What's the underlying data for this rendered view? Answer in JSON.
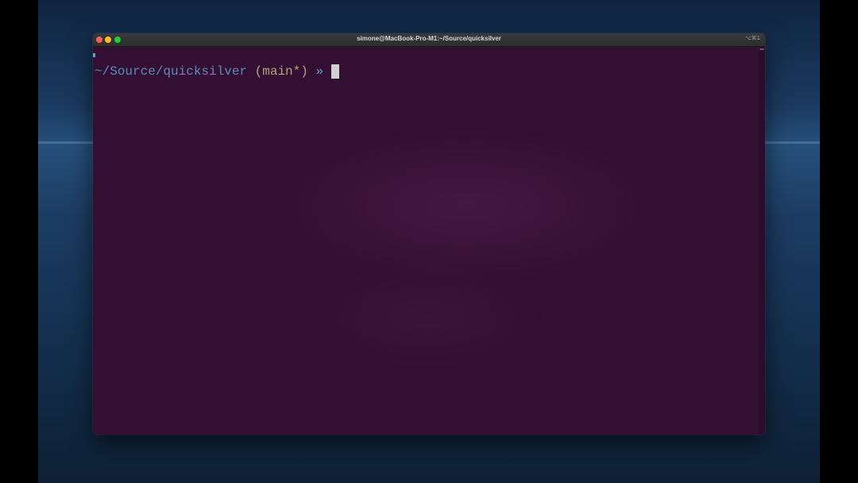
{
  "window": {
    "title": "simone@MacBook-Pro-M1:~/Source/quicksilver",
    "shortcut": "⌥⌘1"
  },
  "terminal": {
    "path": "~/Source/quicksilver",
    "branch_open": " (",
    "branch": "main",
    "dirty_marker": "*",
    "branch_close": ")",
    "prompt_symbol": " » "
  },
  "colors": {
    "terminal_background": "#330f33",
    "path": "#5b8dbb",
    "branch": "#b3a37a",
    "dirty": "#c9a85f",
    "prompt_symbol": "#6ea0cf"
  }
}
